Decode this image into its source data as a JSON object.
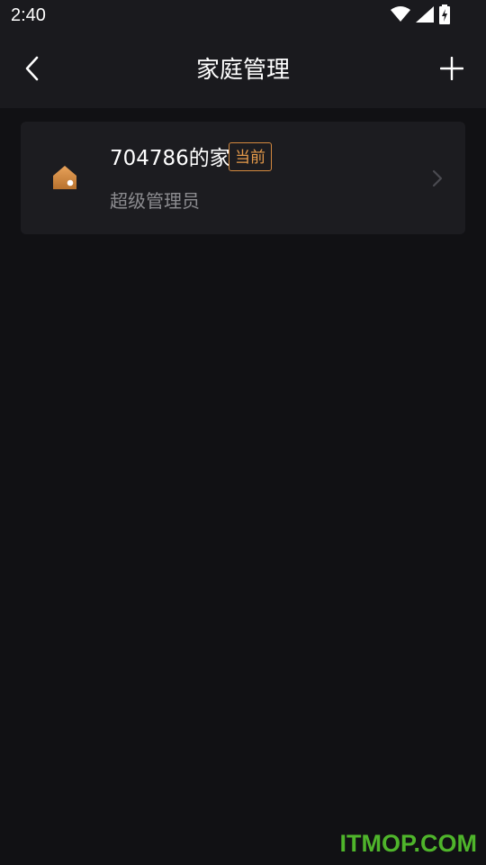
{
  "status_bar": {
    "time": "2:40",
    "icons": [
      "wifi-icon",
      "signal-icon",
      "battery-charging-icon"
    ]
  },
  "header": {
    "title": "家庭管理",
    "back_icon": "chevron-left-icon",
    "add_icon": "plus-icon"
  },
  "homes": [
    {
      "name": "704786的家",
      "badge": "当前",
      "role": "超级管理员",
      "icon": "home-icon"
    }
  ],
  "colors": {
    "background": "#111114",
    "header": "#1a1a1e",
    "card": "#1c1c20",
    "accent": "#e59a4a",
    "secondary_text": "#8c8c90",
    "watermark": "#4fb52b"
  },
  "watermark": "ITMOP.COM"
}
